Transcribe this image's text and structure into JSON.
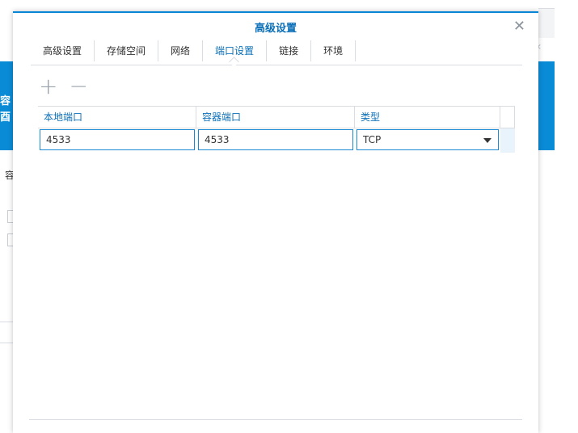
{
  "background": {
    "blue_chars": [
      "容",
      "酉"
    ],
    "left_char": "容"
  },
  "dialog": {
    "title": "高级设置",
    "close_icon": "close-icon",
    "tabs": [
      {
        "label": "高级设置",
        "active": false
      },
      {
        "label": "存储空间",
        "active": false
      },
      {
        "label": "网络",
        "active": false
      },
      {
        "label": "端口设置",
        "active": true
      },
      {
        "label": "链接",
        "active": false
      },
      {
        "label": "环境",
        "active": false
      }
    ],
    "toolbar": {
      "add_icon": "plus-icon",
      "remove_icon": "minus-icon"
    },
    "grid": {
      "headers": [
        "本地端口",
        "容器端口",
        "类型"
      ],
      "rows": [
        {
          "local_port": "4533",
          "container_port": "4533",
          "type": "TCP"
        }
      ]
    }
  },
  "colors": {
    "accent": "#0a86d6",
    "header_text": "#0a6fb8",
    "background_blue": "#0a8bd6"
  }
}
